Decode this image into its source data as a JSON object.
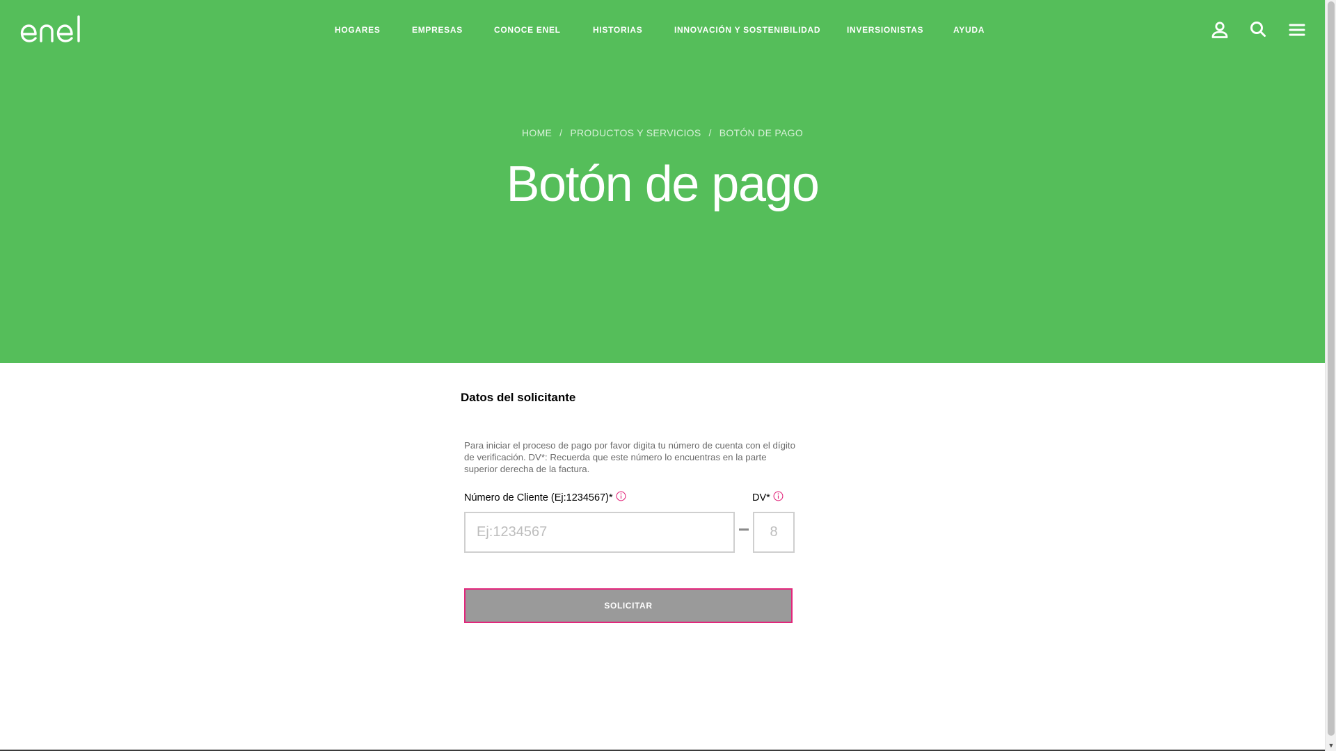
{
  "header": {
    "logo_text": "enel",
    "nav": [
      {
        "label": "HOGARES"
      },
      {
        "label": "EMPRESAS"
      },
      {
        "label": "CONOCE ENEL"
      },
      {
        "label": "HISTORIAS"
      },
      {
        "label": "INNOVACIÓN Y SOSTENIBILIDAD"
      },
      {
        "label": "INVERSIONISTAS"
      },
      {
        "label": "AYUDA"
      }
    ],
    "icons": [
      "user-icon",
      "search-icon",
      "menu-icon"
    ]
  },
  "breadcrumb": {
    "items": [
      "HOME",
      "PRODUCTOS Y SERVICIOS",
      "BOTÓN DE PAGO"
    ],
    "separator": "/"
  },
  "page": {
    "title": "Botón de pago"
  },
  "form": {
    "section_title": "Datos del solicitante",
    "intro": "Para iniciar el proceso de pago por favor digita tu número de cuenta con el dígito de verificación. DV*: Recuerda que este número lo encuentras en la parte superior derecha de la factura.",
    "client_label": "Número de Cliente (Ej:1234567)*",
    "client_placeholder": "Ej:1234567",
    "client_value": "",
    "dv_label": "DV*",
    "dv_placeholder": "8",
    "dv_value": "",
    "submit_label": "SOLICITAR"
  },
  "colors": {
    "brand_green": "#55be5a",
    "accent_pink": "#e2267b",
    "button_gray": "#9a9a9a"
  }
}
